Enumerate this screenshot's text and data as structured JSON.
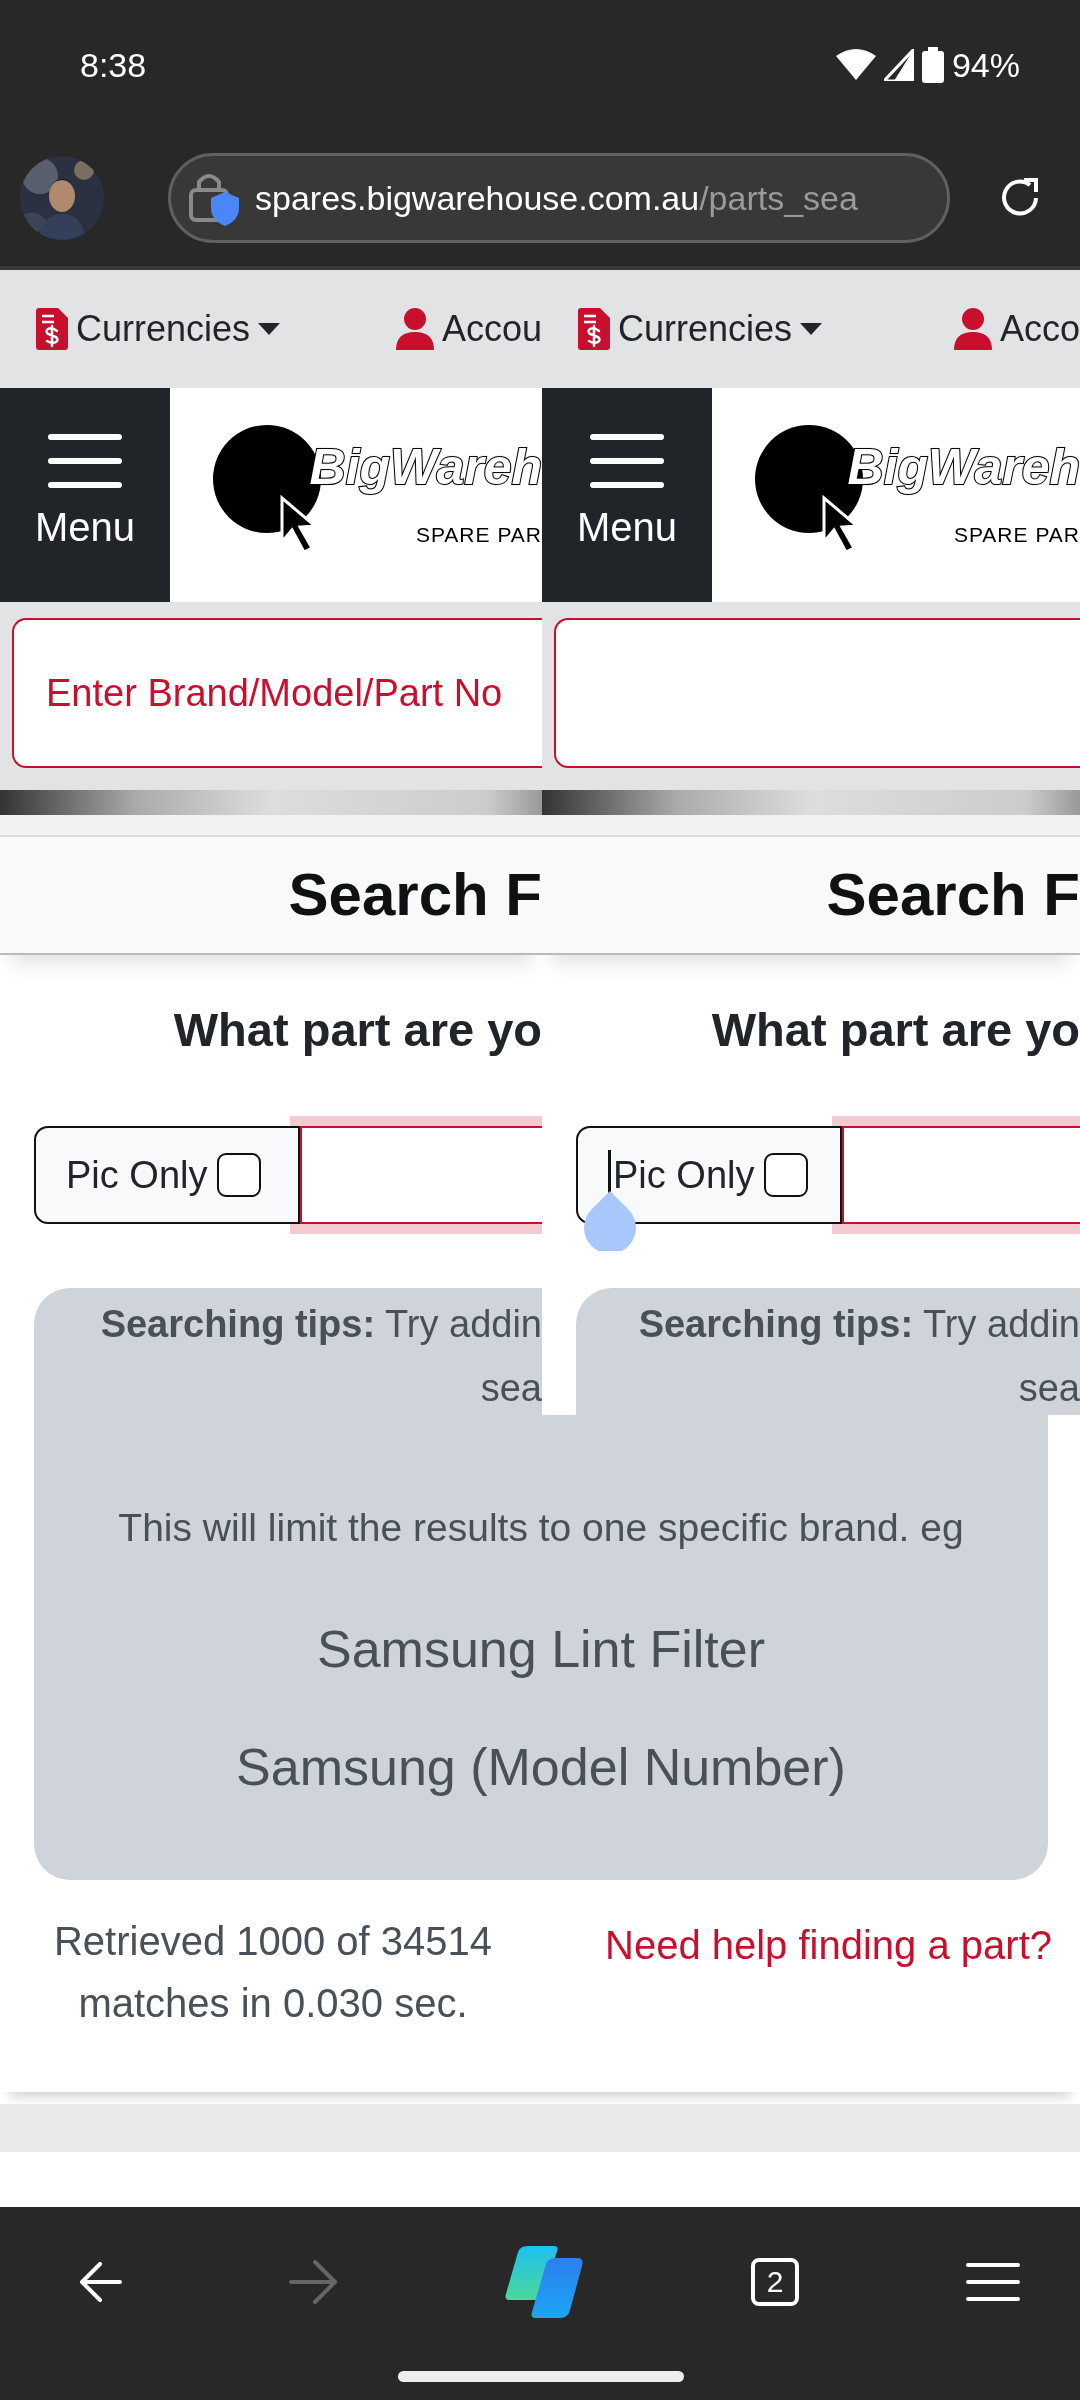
{
  "status_bar": {
    "time": "8:38",
    "battery": "94%"
  },
  "browser": {
    "url_host": "spares.bigwarehouse.com.au",
    "url_path": "/parts_sea"
  },
  "panes": [
    {
      "currency_label": "Currencies",
      "account_label": "Accou",
      "menu_label": "Menu",
      "logo_text": "BigWareh",
      "logo_tagline": "SPARE PAR",
      "search": {
        "placeholder": "Enter Brand/Model/Part No"
      },
      "heading": "Search F",
      "subheading": "What part are yo",
      "pic_only": {
        "label": "Pic Only",
        "checked": false
      },
      "text_cursor": false,
      "tips_label": "Searching tips:",
      "tips_text": "Try addin",
      "tips_line_2": "sea"
    },
    {
      "currency_label": "Currencies",
      "account_label": "Acco",
      "menu_label": "Menu",
      "logo_text": "BigWareh",
      "logo_tagline": "SPARE PAR",
      "heading": "Search F",
      "subheading": "What part are yo",
      "pic_only": {
        "label": "Pic Only",
        "checked": false
      },
      "text_cursor": true,
      "tips_label": "Searching tips:",
      "tips_text": "Try addin",
      "tips_line_2": "sea"
    }
  ],
  "tips": {
    "text": "This will limit the results to one specific brand. eg",
    "examples": [
      "Samsung Lint Filter",
      "Samsung (Model Number)"
    ]
  },
  "results": {
    "summary": "Retrieved 1000 of 34514 matches in 0.030 sec.",
    "help_link": "Need help finding a part?"
  },
  "bottom_nav": {
    "tab_count": "2",
    "forward_disabled": true
  }
}
